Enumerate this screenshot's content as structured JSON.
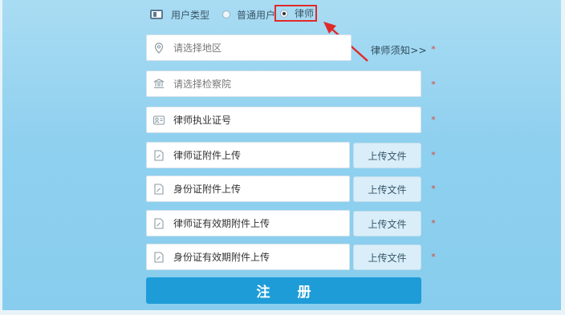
{
  "user_type": {
    "label": "用户类型",
    "options": [
      {
        "label": "普通用户",
        "selected": false
      },
      {
        "label": "律师",
        "selected": true
      }
    ]
  },
  "fields": {
    "region": {
      "placeholder": "请选择地区",
      "icon": "location-pin-icon"
    },
    "procuratorate": {
      "placeholder": "请选择检察院",
      "icon": "court-building-icon"
    },
    "license_no": {
      "label": "律师执业证号",
      "icon": "id-card-icon"
    },
    "lawyer_cert_upload": {
      "label": "律师证附件上传",
      "icon": "file-edit-icon"
    },
    "id_card_upload": {
      "label": "身份证附件上传",
      "icon": "file-edit-icon"
    },
    "lawyer_cert_validity_upload": {
      "label": "律师证有效期附件上传",
      "icon": "file-edit-icon"
    },
    "id_card_validity_upload": {
      "label": "身份证有效期附件上传",
      "icon": "file-edit-icon"
    }
  },
  "upload_button_label": "上传文件",
  "lawyer_notice": "律师须知>>",
  "required_mark": "*",
  "register_button": "注 册",
  "colors": {
    "accent": "#1e9cd8",
    "highlight": "#e02a2a",
    "required": "#d9453c"
  }
}
